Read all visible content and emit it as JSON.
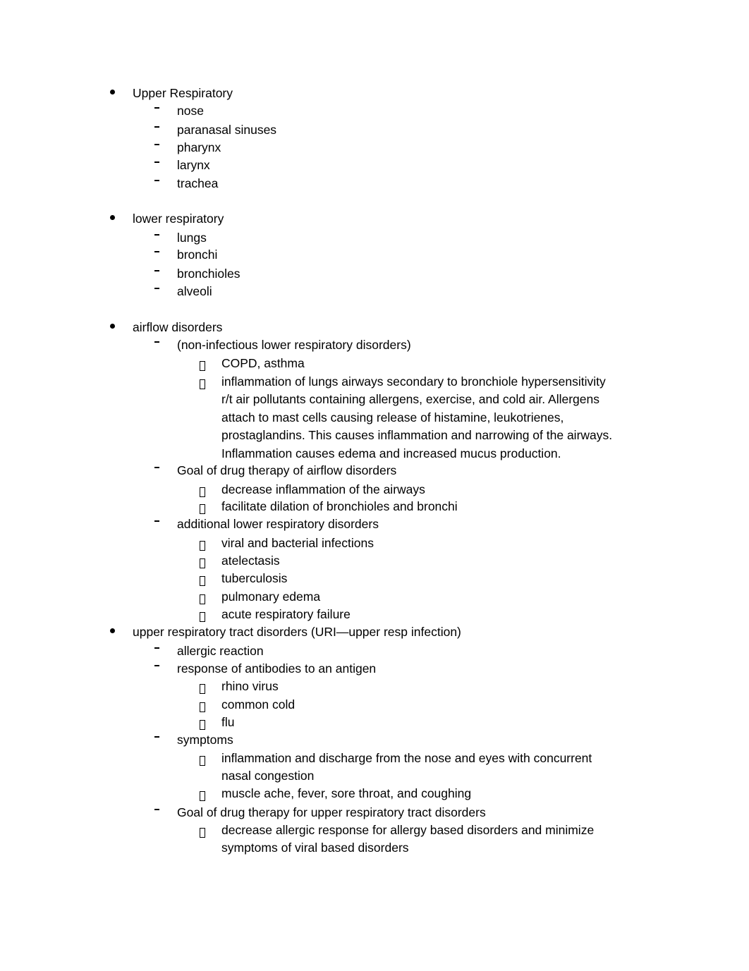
{
  "document": {
    "sections": [
      {
        "lines": [
          "Upper Respiratory"
        ],
        "children": [
          {
            "lines": [
              "nose"
            ]
          },
          {
            "lines": [
              "paranasal sinuses"
            ]
          },
          {
            "lines": [
              "pharynx"
            ]
          },
          {
            "lines": [
              "larynx"
            ]
          },
          {
            "lines": [
              "trachea"
            ]
          }
        ]
      },
      {
        "lines": [
          "lower respiratory"
        ],
        "children": [
          {
            "lines": [
              "lungs"
            ]
          },
          {
            "lines": [
              "bronchi"
            ]
          },
          {
            "lines": [
              "bronchioles"
            ]
          },
          {
            "lines": [
              "alveoli"
            ]
          }
        ]
      },
      {
        "lines": [
          "airflow disorders"
        ],
        "children": [
          {
            "lines": [
              "(non-infectious lower respiratory disorders)"
            ],
            "children": [
              {
                "lines": [
                  "COPD, asthma"
                ]
              },
              {
                "lines": [
                  "inflammation of lungs airways secondary to bronchiole hypersensitivity",
                  "r/t air pollutants containing allergens, exercise, and cold air. Allergens",
                  "attach to mast cells causing release of histamine, leukotrienes,",
                  "prostaglandins. This causes inflammation and narrowing of the airways.",
                  "Inflammation causes edema and increased mucus production."
                ]
              }
            ]
          },
          {
            "lines": [
              "Goal of drug therapy of airflow disorders"
            ],
            "children": [
              {
                "lines": [
                  "decrease inflammation of the airways"
                ]
              },
              {
                "lines": [
                  "facilitate dilation of bronchioles and bronchi"
                ]
              }
            ]
          },
          {
            "lines": [
              "additional lower respiratory disorders"
            ],
            "children": [
              {
                "lines": [
                  "viral and bacterial infections"
                ]
              },
              {
                "lines": [
                  "atelectasis"
                ]
              },
              {
                "lines": [
                  "tuberculosis"
                ]
              },
              {
                "lines": [
                  "pulmonary edema"
                ]
              },
              {
                "lines": [
                  "acute respiratory failure"
                ]
              }
            ]
          }
        ]
      },
      {
        "lines": [
          "upper respiratory tract disorders (URI—upper resp infection)"
        ],
        "children": [
          {
            "lines": [
              "allergic reaction"
            ]
          },
          {
            "lines": [
              "response of antibodies to an antigen"
            ],
            "children": [
              {
                "lines": [
                  "rhino virus"
                ]
              },
              {
                "lines": [
                  "common cold"
                ]
              },
              {
                "lines": [
                  "flu"
                ]
              }
            ]
          },
          {
            "lines": [
              "symptoms"
            ],
            "children": [
              {
                "lines": [
                  "inflammation and discharge from the nose and eyes with concurrent",
                  "nasal congestion"
                ]
              },
              {
                "lines": [
                  "muscle ache, fever, sore throat, and coughing"
                ]
              }
            ]
          },
          {
            "lines": [
              "Goal of drug therapy for upper respiratory tract disorders"
            ],
            "children": [
              {
                "lines": [
                  "decrease allergic response for allergy based disorders and minimize",
                  "symptoms of viral based disorders"
                ]
              }
            ]
          }
        ]
      }
    ],
    "markers": {
      "level0": "bullet-icon",
      "level1": "dash-icon",
      "level2": "box-icon"
    }
  }
}
